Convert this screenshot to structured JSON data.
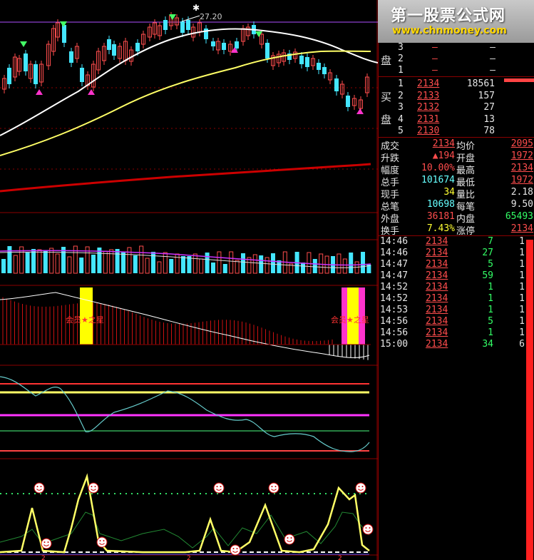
{
  "watermark": {
    "title": "第一股票公式网",
    "url": "www.chnmoney.com"
  },
  "kline": {
    "high_marker": "27.20"
  },
  "signal_labels": {
    "left": "会员★之星",
    "right": "会员★之星"
  },
  "order_book": {
    "sell_side_label": "盘",
    "buy_side_label_top": "买",
    "buy_side_label_bottom": "盘",
    "sell": [
      {
        "level": "3",
        "price": "—",
        "vol": "—"
      },
      {
        "level": "2",
        "price": "—",
        "vol": "—"
      },
      {
        "level": "1",
        "price": "—",
        "vol": "—"
      }
    ],
    "buy": [
      {
        "level": "1",
        "price": "2134",
        "vol": "18561"
      },
      {
        "level": "2",
        "price": "2133",
        "vol": "157"
      },
      {
        "level": "3",
        "price": "2132",
        "vol": "27"
      },
      {
        "level": "4",
        "price": "2131",
        "vol": "13"
      },
      {
        "level": "5",
        "price": "2130",
        "vol": "78"
      }
    ]
  },
  "stats": [
    {
      "l1": "成交",
      "v1": "2134",
      "c1": "red",
      "l2": "均价",
      "v2": "2095",
      "c2": "red"
    },
    {
      "l1": "升跌",
      "v1": "▲194",
      "c1": "red",
      "l2": "开盘",
      "v2": "1972",
      "c2": "red"
    },
    {
      "l1": "幅度",
      "v1": "10.00%",
      "c1": "red",
      "l2": "最高",
      "v2": "2134",
      "c2": "red"
    },
    {
      "l1": "总手",
      "v1": "101674",
      "c1": "cyan",
      "l2": "最低",
      "v2": "1972",
      "c2": "red"
    },
    {
      "l1": "现手",
      "v1": "34",
      "c1": "yellow",
      "l2": "量比",
      "v2": "2.18",
      "c2": "white"
    },
    {
      "l1": "总笔",
      "v1": "10698",
      "c1": "cyan",
      "l2": "每笔",
      "v2": "9.50",
      "c2": "white"
    },
    {
      "l1": "外盘",
      "v1": "36181",
      "c1": "red",
      "l2": "内盘",
      "v2": "65493",
      "c2": "green"
    },
    {
      "l1": "换手",
      "v1": "7.43%",
      "c1": "yellow",
      "l2": "涨停",
      "v2": "2134",
      "c2": "red"
    }
  ],
  "ticks": [
    {
      "time": "14:46",
      "price": "2134",
      "vol": "7",
      "n": "1"
    },
    {
      "time": "14:46",
      "price": "2134",
      "vol": "27",
      "n": "1"
    },
    {
      "time": "14:47",
      "price": "2134",
      "vol": "5",
      "n": "1"
    },
    {
      "time": "14:47",
      "price": "2134",
      "vol": "59",
      "n": "1"
    },
    {
      "time": "14:52",
      "price": "2134",
      "vol": "1",
      "n": "1"
    },
    {
      "time": "14:52",
      "price": "2134",
      "vol": "1",
      "n": "1"
    },
    {
      "time": "14:53",
      "price": "2134",
      "vol": "1",
      "n": "1"
    },
    {
      "time": "14:56",
      "price": "2134",
      "vol": "5",
      "n": "1"
    },
    {
      "time": "14:56",
      "price": "2134",
      "vol": "1",
      "n": "1"
    },
    {
      "time": "15:00",
      "price": "2134",
      "vol": "34",
      "n": "6"
    }
  ],
  "colors": {
    "up": "#ff4d4d",
    "down": "#44e6ff",
    "ma_white": "#ffffff",
    "ma_yellow": "#ffff66",
    "ma_red": "#cc0000",
    "magenta": "#ff33cc",
    "panel_border": "#8b0000"
  }
}
